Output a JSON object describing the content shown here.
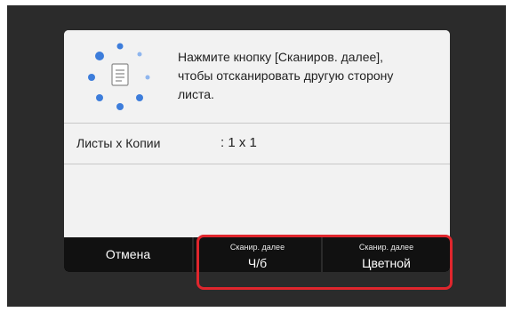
{
  "dialog": {
    "message": "Нажмите кнопку [Сканиров. далее],\nчтобы отсканировать другую сторону\nлиста.",
    "info_label": "Листы x Копии",
    "info_value": ": 1 x 1"
  },
  "buttons": {
    "cancel_label": "Отмена",
    "bw_sub": "Сканир. далее",
    "bw_main": "Ч/б",
    "color_sub": "Сканир. далее",
    "color_main": "Цветной"
  },
  "icons": {
    "scan_status": "document-spinner-icon"
  },
  "colors": {
    "highlight": "#e0262d",
    "spinner_dots": "#3d7ddb"
  }
}
